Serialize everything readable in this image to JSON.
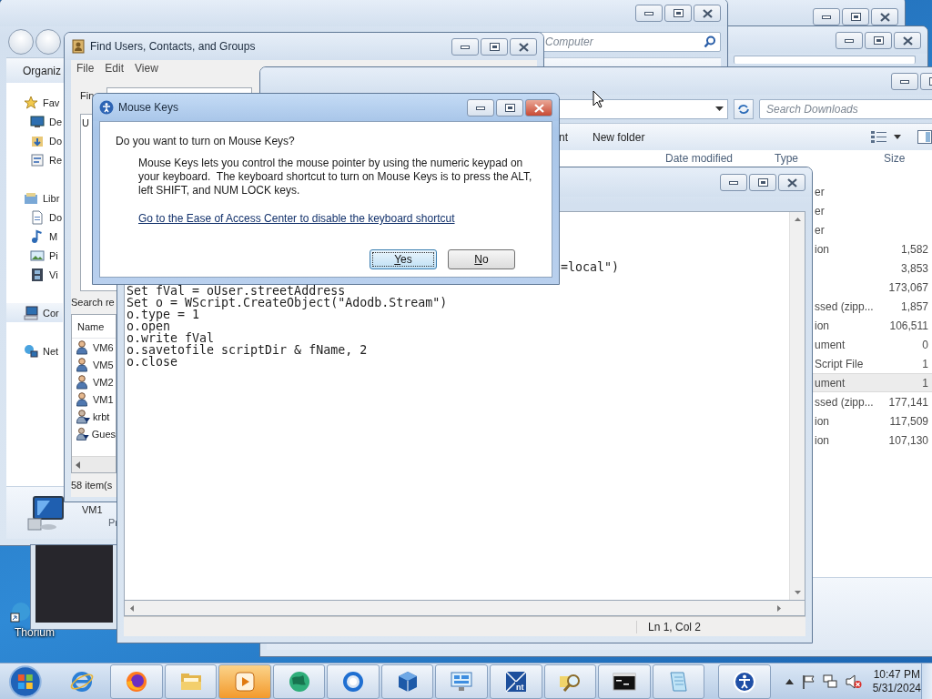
{
  "desktop": {
    "icons": [
      {
        "label": "Thorium"
      }
    ]
  },
  "background_windows": [
    {
      "active": false
    },
    {
      "active": false
    }
  ],
  "computer_window": {
    "active": false,
    "search": {
      "placeholder": "Computer"
    },
    "toolbar": [
      "Organiz"
    ],
    "sidebar": [
      {
        "label": "Fav",
        "kind": "star",
        "selected": false,
        "children": [
          {
            "label": "De",
            "kind": "desktop",
            "selected": false
          },
          {
            "label": "Do",
            "kind": "downloads",
            "selected": false
          },
          {
            "label": "Re",
            "kind": "recent",
            "selected": false
          }
        ]
      },
      {
        "label": "Libr",
        "kind": "library",
        "selected": false,
        "children": [
          {
            "label": "Do",
            "kind": "document",
            "selected": false
          },
          {
            "label": "M",
            "kind": "music",
            "selected": false
          },
          {
            "label": "Pi",
            "kind": "pictures",
            "selected": false
          },
          {
            "label": "Vi",
            "kind": "video",
            "selected": false
          }
        ]
      },
      {
        "label": "Cor",
        "kind": "computer",
        "selected": true
      },
      {
        "label": "Net",
        "kind": "network",
        "selected": false
      }
    ],
    "details": {
      "name": "VM1",
      "line": "Pr"
    }
  },
  "find_window": {
    "title": "Find Users, Contacts, and Groups",
    "active": false,
    "menu": [
      "File",
      "Edit",
      "View"
    ],
    "find_label": "Fin",
    "box_text": "U",
    "results_label": "Search re",
    "columns": [
      "Name"
    ],
    "rows": [
      {
        "name": "VM6",
        "disabled": false
      },
      {
        "name": "VM5",
        "disabled": false
      },
      {
        "name": "VM2",
        "disabled": false
      },
      {
        "name": "VM1",
        "disabled": false
      },
      {
        "name": "krbt",
        "disabled": true
      },
      {
        "name": "Gues",
        "disabled": true
      }
    ],
    "status": "58 item(s"
  },
  "downloads_window": {
    "active": false,
    "search": {
      "placeholder": "Search Downloads"
    },
    "toolbar": [
      "nt",
      "New folder"
    ],
    "columns": [
      "Date modified",
      "Type",
      "Size"
    ],
    "rows": [
      {
        "type": "er",
        "size": "",
        "selected": false
      },
      {
        "type": "er",
        "size": "",
        "selected": false
      },
      {
        "type": "er",
        "size": "",
        "selected": false
      },
      {
        "type": "ion",
        "size": "1,582",
        "selected": false
      },
      {
        "type": "",
        "size": "3,853",
        "selected": false
      },
      {
        "type": "",
        "size": "173,067",
        "selected": false
      },
      {
        "type": "ssed (zipp...",
        "size": "1,857",
        "selected": false
      },
      {
        "type": "ion",
        "size": "106,511",
        "selected": false
      },
      {
        "type": "ument",
        "size": "0",
        "selected": false
      },
      {
        "type": "Script File",
        "size": "1",
        "selected": false
      },
      {
        "type": "ument",
        "size": "1",
        "selected": true
      },
      {
        "type": "ssed (zipp...",
        "size": "177,141",
        "selected": false
      },
      {
        "type": "ion",
        "size": "117,509",
        "selected": false
      },
      {
        "type": "ion",
        "size": "107,130",
        "selected": false
      }
    ]
  },
  "notepad": {
    "active": false,
    "clipped_line": "=local\")",
    "lines": [
      "Set fVal = oUser.streetAddress",
      "Set o = WScript.CreateObject(\"Adodb.Stream\")",
      "o.type = 1",
      "o.open",
      "o.write fVal",
      "o.savetofile scriptDir & fName, 2",
      "o.close"
    ],
    "status": "Ln 1, Col 2"
  },
  "dialog": {
    "title": "Mouse Keys",
    "active": true,
    "question": "Do you want to turn on Mouse Keys?",
    "body": "Mouse Keys lets you control the mouse pointer by using the numeric keypad on your keyboard.  The keyboard shortcut to turn on Mouse Keys is to press the ALT, left SHIFT, and NUM LOCK keys.",
    "link": "Go to the Ease of Access Center to disable the keyboard shortcut",
    "buttons": [
      {
        "label": "Yes",
        "default": true
      },
      {
        "label": "No",
        "default": false
      }
    ]
  },
  "taskbar": {
    "pinned_items": [
      {
        "kind": "ie"
      }
    ],
    "items": [
      {
        "kind": "firefox",
        "highlighted": false
      },
      {
        "kind": "folder",
        "highlighted": false
      },
      {
        "kind": "media",
        "highlighted": true
      },
      {
        "kind": "globe",
        "highlighted": false
      },
      {
        "kind": "ring",
        "highlighted": false
      },
      {
        "kind": "cube",
        "highlighted": false
      },
      {
        "kind": "panel",
        "highlighted": false
      },
      {
        "kind": "nt",
        "label": "nt",
        "highlighted": false
      },
      {
        "kind": "magnifier",
        "highlighted": false
      },
      {
        "kind": "console",
        "highlighted": false
      },
      {
        "kind": "notepad",
        "highlighted": false
      }
    ],
    "extra_items": [
      {
        "kind": "accessibility",
        "highlighted": false
      }
    ],
    "clock": {
      "time": "10:47 PM",
      "date": "5/31/2024"
    }
  }
}
